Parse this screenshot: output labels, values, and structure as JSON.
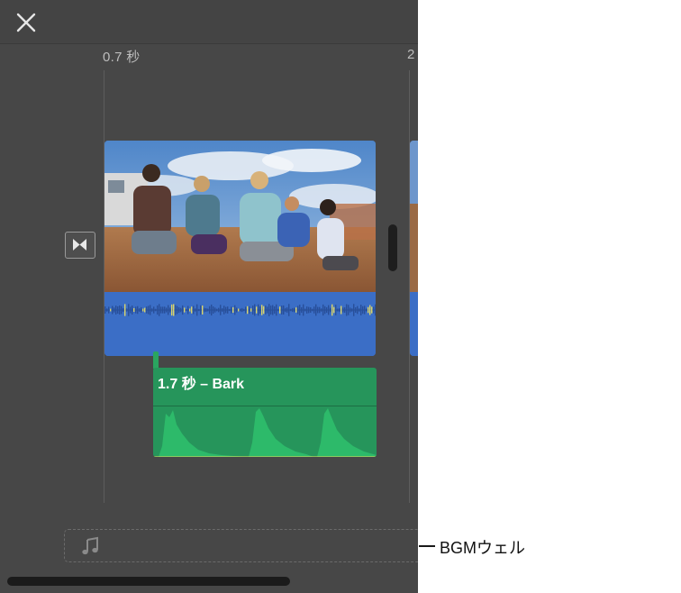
{
  "timeline": {
    "timestamps": [
      "0.7 秒",
      "2"
    ],
    "video_clip": {
      "colors": {
        "video": "#3b6ec6"
      }
    },
    "sound_effect_clip": {
      "label": "1.7 秒 – Bark",
      "color": "#26955b"
    },
    "bgm_well": {
      "icon": "music-note-icon"
    },
    "close_icon": "close-icon",
    "transition_icon": "transition-icon"
  },
  "callout": {
    "label": "BGMウェル"
  }
}
